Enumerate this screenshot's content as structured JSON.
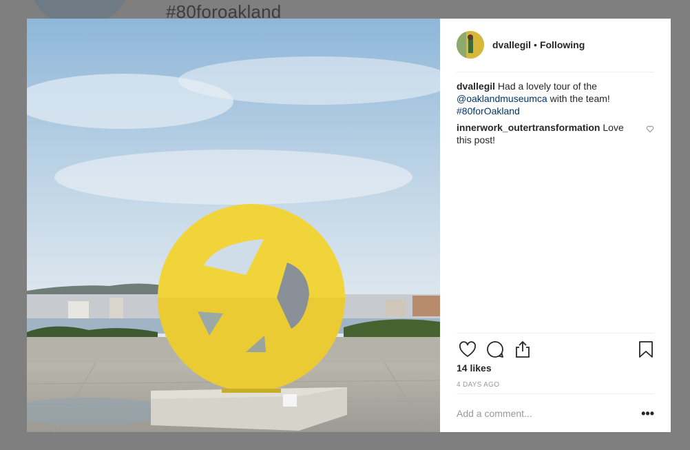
{
  "background": {
    "title": "#80foroakland"
  },
  "post": {
    "username": "dvallegil",
    "separator": "•",
    "follow_status": "Following",
    "caption": {
      "username": "dvallegil",
      "text_before": "Had a lovely tour of the ",
      "mention": "@oaklandmuseumca",
      "text_after": " with the team!",
      "hashtag": "#80forOakland"
    },
    "comment": {
      "username": "innerwork_outertransformation",
      "text": "Love this post!"
    },
    "likes": "14 likes",
    "time": "4 DAYS AGO",
    "add_comment_placeholder": "Add a comment...",
    "more_label": "•••"
  },
  "icons": {
    "like": "heart-icon",
    "comment": "comment-icon",
    "share": "share-icon",
    "save": "bookmark-icon",
    "comment_like": "heart-icon"
  },
  "colors": {
    "sculpture_yellow": "#f0d43a",
    "link": "#003569",
    "overlay": "#7f7f7f"
  }
}
